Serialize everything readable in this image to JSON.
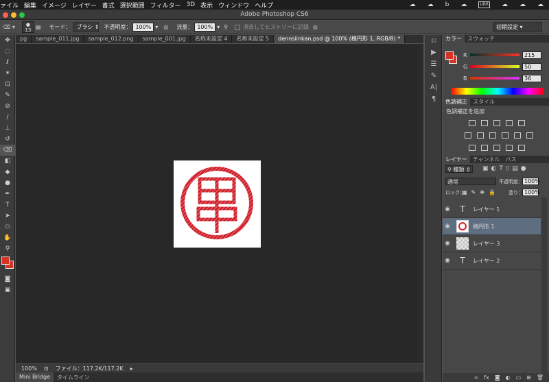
{
  "menubar": {
    "items": [
      "ァイル",
      "編集",
      "イメージ",
      "レイヤー",
      "書式",
      "選択範囲",
      "フィルター",
      "3D",
      "表示",
      "ウィンドウ",
      "ヘルプ"
    ],
    "tray": [
      "☁",
      "☁",
      "b",
      "☁",
      "UBR",
      "☁",
      "☁",
      "☁"
    ]
  },
  "titlebar": {
    "title": "Adobe Photoshop CS6"
  },
  "options": {
    "brush_size": "13",
    "mode_label": "モード：",
    "mode_value": "ブラシ",
    "opacity_label": "不透明度：",
    "opacity_value": "100%",
    "flow_label": "流量：",
    "flow_value": "100%",
    "history_erase": "消去してヒストリーに記録",
    "workspace": "初期設定"
  },
  "tabs": [
    "pg",
    "sample_011.jpg",
    "sample_012.png",
    "sample_001.jpg",
    "名称未設定 4",
    "名称未設定 5",
    "dennsiinkan.psd @ 100% (楕円形 1, RGB/8) *"
  ],
  "status": {
    "zoom": "100%",
    "file": "ファイル：117.2K/117.2K"
  },
  "bottom_tabs": [
    "Mini Bridge",
    "タイムライン"
  ],
  "color_panel": {
    "tabs": [
      "カラー",
      "スウォッチ"
    ],
    "r_label": "R",
    "g_label": "G",
    "b_label": "B",
    "r": "215",
    "g": "50",
    "b": "36",
    "fg_color": "#d73224"
  },
  "adjust_panel": {
    "tabs": [
      "色調補正",
      "スタイル"
    ],
    "add_label": "色調補正を追加"
  },
  "layers_panel": {
    "tabs": [
      "レイヤー",
      "チャンネル",
      "パス"
    ],
    "filter": "種類",
    "blend": "通常",
    "opacity_label": "不透明度：",
    "opacity": "100%",
    "lock_label": "ロック：",
    "fill_label": "塗り：",
    "fill": "100%",
    "layers": [
      {
        "name": "レイヤー 1",
        "type": "text"
      },
      {
        "name": "楕円形 1",
        "type": "shape"
      },
      {
        "name": "レイヤー 3",
        "type": "pixel"
      },
      {
        "name": "レイヤー 2",
        "type": "text"
      }
    ]
  },
  "seal": {
    "char": "田中",
    "color": "#d0202a"
  }
}
